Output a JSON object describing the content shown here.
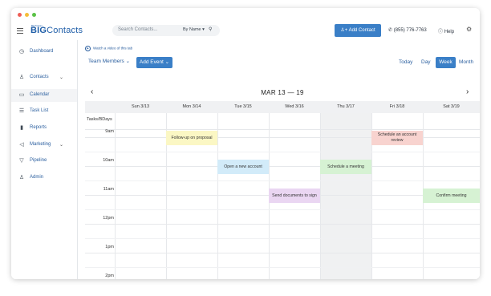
{
  "topbar": {
    "logo_small": "BigTinCan",
    "logo_big": "BIG",
    "logo_rest": "Contacts",
    "search_placeholder": "Search Contacts...",
    "search_by": "By Name ▾",
    "add_contact_label": "Add Contact",
    "phone": "(855) 776-7763",
    "help_label": "Help"
  },
  "sidebar": {
    "items": [
      {
        "label": "Dashboard",
        "icon": "dashboard-icon",
        "glyph": "◷"
      },
      {
        "label": "Contacts",
        "icon": "person-icon",
        "glyph": "♙",
        "chevron": "⌄"
      },
      {
        "label": "Calendar",
        "icon": "calendar-icon",
        "glyph": "▭",
        "active": true
      },
      {
        "label": "Task List",
        "icon": "list-icon",
        "glyph": "☰"
      },
      {
        "label": "Reports",
        "icon": "bar-chart-icon",
        "glyph": "▮"
      },
      {
        "label": "Marketing",
        "icon": "megaphone-icon",
        "glyph": "◁",
        "chevron": "⌄"
      },
      {
        "label": "Pipeline",
        "icon": "funnel-icon",
        "glyph": "▽"
      },
      {
        "label": "Admin",
        "icon": "people-icon",
        "glyph": "♙"
      }
    ]
  },
  "toolbar": {
    "video_link": "Watch a video of this tab",
    "team_members": "Team Members ⌄",
    "add_event": "Add Event ⌄",
    "today": "Today",
    "day": "Day",
    "week": "Week",
    "month": "Month"
  },
  "calendar": {
    "range": "MAR 13 — 19",
    "days": [
      "Sun 3/13",
      "Mon 3/14",
      "Tue 3/15",
      "Wed 3/16",
      "Thu 3/17",
      "Fri 3/18",
      "Sat 3/19"
    ],
    "tasks_label": "Tasks/BDays",
    "times": [
      "9am",
      "10am",
      "11am",
      "12pm",
      "1pm",
      "2pm"
    ],
    "events": [
      {
        "title": "Follow-up on proposal",
        "day": "Mon 3/14",
        "time": "9am",
        "color": "#fbf7c4"
      },
      {
        "title": "Schedule an account review",
        "day": "Fri 3/18",
        "time": "9am",
        "color": "#f8d3cf"
      },
      {
        "title": "Open a new account",
        "day": "Tue 3/15",
        "time": "10am",
        "color": "#d2ebf9"
      },
      {
        "title": "Schedule a meeting",
        "day": "Thu 3/17",
        "time": "10am",
        "color": "#d6f2d3"
      },
      {
        "title": "Send documents to sign",
        "day": "Wed 3/16",
        "time": "11am",
        "color": "#ead6f2"
      },
      {
        "title": "Confirm meeting",
        "day": "Sat 3/19",
        "time": "11am",
        "color": "#d6f2d3"
      }
    ]
  },
  "colors": {
    "accent": "#3a7fc7",
    "link": "#2b5f9f"
  }
}
